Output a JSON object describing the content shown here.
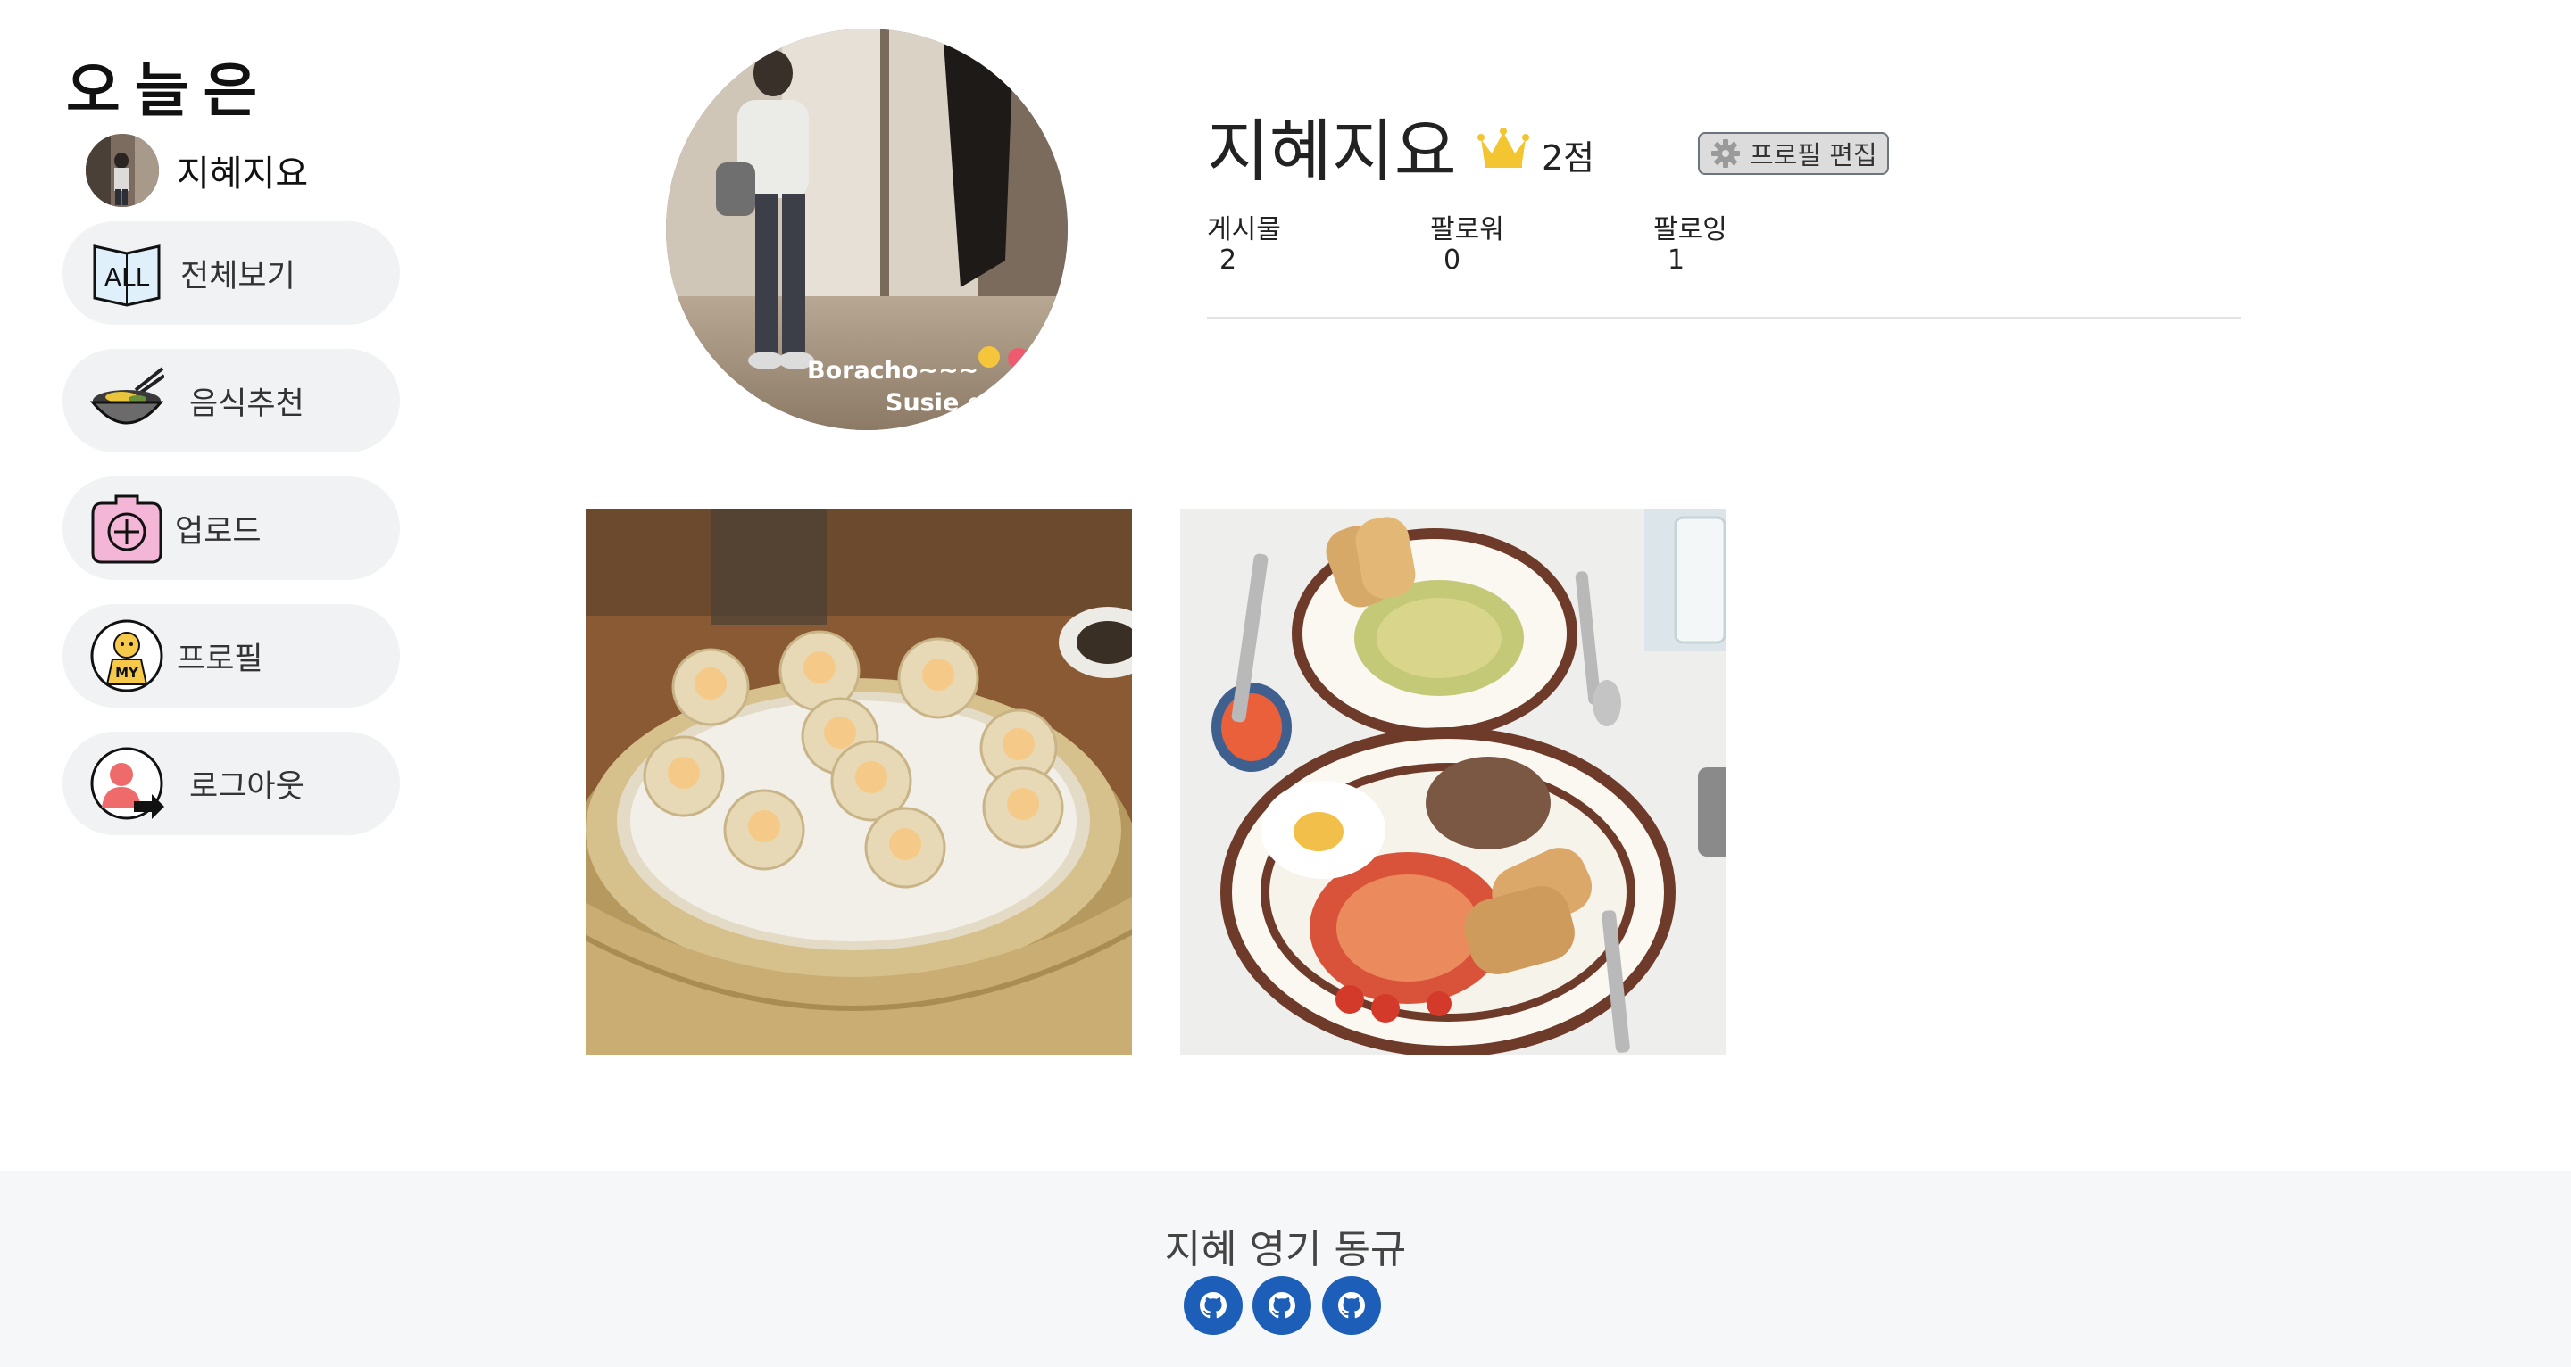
{
  "app": {
    "logo": "오늘은"
  },
  "sidebar": {
    "username": "지혜지요",
    "items": [
      {
        "label": "전체보기",
        "icon": "all-book-icon"
      },
      {
        "label": "음식추천",
        "icon": "noodle-bowl-icon"
      },
      {
        "label": "업로드",
        "icon": "upload-plus-icon"
      },
      {
        "label": "프로필",
        "icon": "my-profile-icon"
      },
      {
        "label": "로그아웃",
        "icon": "logout-person-icon"
      }
    ],
    "all_icon_text": "ALL",
    "my_icon_text": "MY"
  },
  "profile": {
    "name": "지혜지요",
    "score": "2점",
    "edit_label": "프로필 편집",
    "photo_caption_1": "Boracho~~~",
    "photo_caption_2": "Susie g",
    "stats": [
      {
        "label": "게시물",
        "value": "2"
      },
      {
        "label": "팔로워",
        "value": "0"
      },
      {
        "label": "팔로잉",
        "value": "1"
      }
    ]
  },
  "posts": [
    {
      "alt": "dumplings-in-steamer"
    },
    {
      "alt": "pasta-and-plate-meal"
    }
  ],
  "footer": {
    "title": "지혜 영기 동규",
    "links": [
      "github-icon",
      "github-icon",
      "github-icon"
    ]
  },
  "colors": {
    "nav_bg": "#f1f2f4",
    "footer_bg": "#f6f7f8",
    "github_blue": "#1d5fb8",
    "crown": "#f2c531"
  }
}
